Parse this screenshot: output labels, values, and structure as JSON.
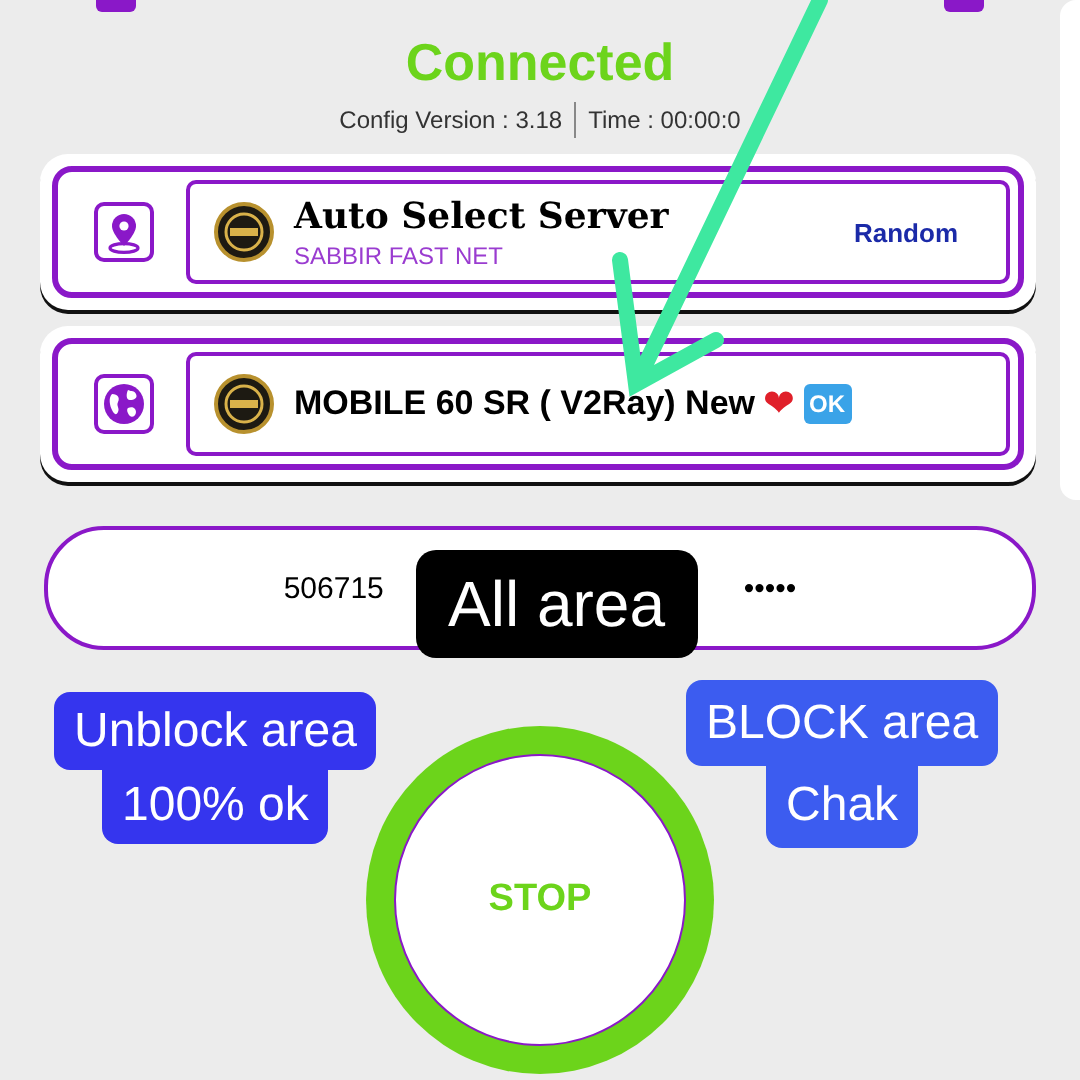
{
  "status": "Connected",
  "info": {
    "config": "Config Version : 3.18",
    "time": "Time : 00:00:0"
  },
  "servers": [
    {
      "kind": "auto",
      "title": "Auto Select Server",
      "subtitle": "SABBIR FAST NET",
      "mode": "Random"
    },
    {
      "kind": "server",
      "name": "MOBILE 60 SR ( V2Ray) New",
      "heart": "❤",
      "badge": "OK"
    }
  ],
  "account": {
    "user": "506715",
    "password": "•••••"
  },
  "button": {
    "label": "STOP"
  },
  "annotations": [
    {
      "kind": "dark",
      "text": "All area"
    },
    {
      "kind": "left",
      "lines": [
        "Unblock area",
        "100% ok"
      ]
    },
    {
      "kind": "right",
      "lines": [
        "BLOCK area",
        "Chak"
      ]
    }
  ]
}
